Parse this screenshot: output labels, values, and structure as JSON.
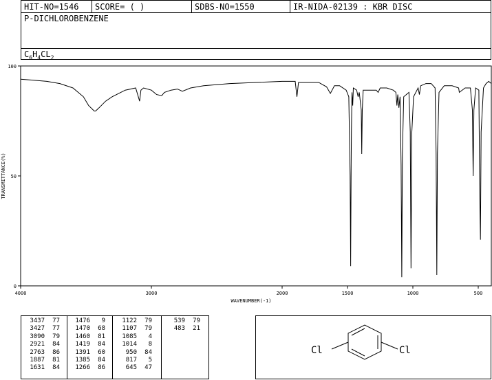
{
  "header": {
    "hit_no": "HIT-NO=1546",
    "score": "SCORE=  (   )",
    "sdbs_no": "SDBS-NO=1550",
    "ir_nida": "IR-NIDA-02139 : KBR DISC"
  },
  "compound": {
    "name": "P-DICHLOROBENZENE",
    "formula_parts": [
      "C",
      "6",
      "H",
      "4",
      "CL",
      "2"
    ]
  },
  "chart_data": {
    "type": "line",
    "xlabel": "WAVENUMBER(-1)",
    "ylabel": "TRANSMITTANCE(%)",
    "xlim": [
      4000,
      400
    ],
    "ylim": [
      0,
      100
    ],
    "x_ticks": [
      4000,
      3000,
      2000,
      1500,
      1000,
      500
    ],
    "y_ticks": [
      0,
      50,
      100
    ],
    "series": [
      {
        "x": [
          4000,
          3900,
          3800,
          3700,
          3600,
          3520,
          3480,
          3437,
          3427,
          3400,
          3350,
          3300,
          3200,
          3120,
          3090,
          3080,
          3060,
          3000,
          2960,
          2921,
          2900,
          2850,
          2800,
          2763,
          2700,
          2600,
          2400,
          2200,
          2000,
          1900,
          1887,
          1875,
          1820,
          1720,
          1660,
          1631,
          1600,
          1560,
          1510,
          1490,
          1480,
          1476,
          1472,
          1470,
          1466,
          1460,
          1455,
          1430,
          1419,
          1410,
          1395,
          1391,
          1387,
          1380,
          1340,
          1300,
          1280,
          1266,
          1250,
          1200,
          1150,
          1130,
          1122,
          1115,
          1107,
          1098,
          1090,
          1085,
          1080,
          1070,
          1050,
          1030,
          1020,
          1014,
          1008,
          995,
          960,
          950,
          940,
          900,
          860,
          830,
          822,
          817,
          812,
          800,
          760,
          700,
          650,
          645,
          600,
          560,
          545,
          539,
          533,
          520,
          495,
          488,
          483,
          478,
          460,
          440,
          420,
          400
        ],
        "y": [
          94,
          93.5,
          93,
          92,
          90,
          86,
          82,
          79.5,
          79.5,
          81,
          84,
          86,
          89,
          90,
          84,
          89,
          90,
          89,
          87,
          86.5,
          88,
          89,
          89.5,
          88.5,
          90,
          91,
          92,
          92.5,
          93,
          93,
          86,
          92.5,
          92.5,
          92.5,
          90.5,
          87.5,
          91,
          91,
          89,
          86,
          50,
          9,
          55,
          70,
          88,
          82,
          90,
          89,
          86,
          88,
          80,
          60,
          80,
          89,
          89,
          89,
          89,
          88,
          90,
          90,
          89,
          88,
          82,
          87,
          81,
          86,
          55,
          4,
          60,
          86,
          87,
          88,
          70,
          8,
          70,
          86,
          90,
          87,
          91,
          92,
          92,
          90,
          60,
          5,
          60,
          88,
          91,
          91,
          90,
          88,
          90,
          90,
          80,
          50,
          80,
          90,
          89,
          40,
          21,
          70,
          90,
          92,
          93,
          92
        ]
      }
    ]
  },
  "peak_table": {
    "columns": [
      [
        [
          "3437",
          "77"
        ],
        [
          "3427",
          "77"
        ],
        [
          "3090",
          "79"
        ],
        [
          "2921",
          "84"
        ],
        [
          "2763",
          "86"
        ],
        [
          "1887",
          "81"
        ],
        [
          "1631",
          "84"
        ]
      ],
      [
        [
          "1476",
          "9"
        ],
        [
          "1470",
          "68"
        ],
        [
          "1460",
          "81"
        ],
        [
          "1419",
          "84"
        ],
        [
          "1391",
          "60"
        ],
        [
          "1385",
          "84"
        ],
        [
          "1266",
          "86"
        ]
      ],
      [
        [
          "1122",
          "79"
        ],
        [
          "1107",
          "79"
        ],
        [
          "1085",
          "4"
        ],
        [
          "1014",
          "8"
        ],
        [
          "950",
          "84"
        ],
        [
          "817",
          "5"
        ],
        [
          "645",
          "47"
        ]
      ],
      [
        [
          "539",
          "79"
        ],
        [
          "483",
          "21"
        ]
      ]
    ]
  },
  "structure": {
    "left_label": "Cl",
    "right_label": "Cl"
  }
}
